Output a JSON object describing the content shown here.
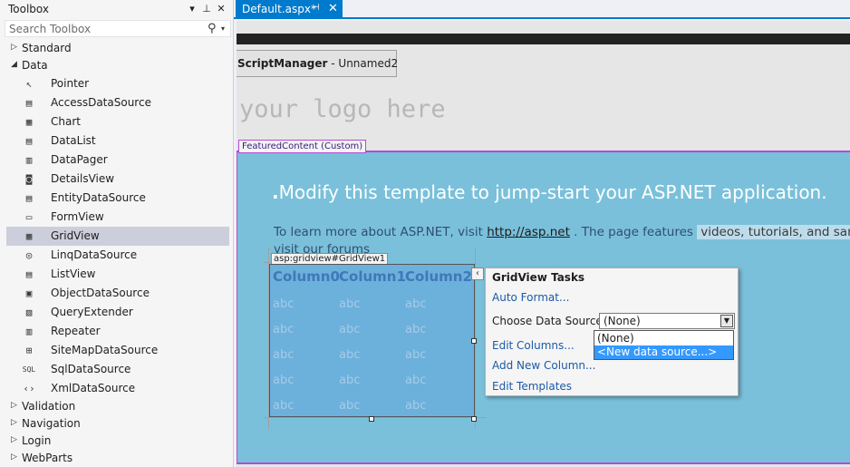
{
  "toolbox": {
    "title": "Toolbox",
    "header_buttons": {
      "dropdown": "▾",
      "pin": "⊥",
      "close": "✕"
    },
    "search": {
      "placeholder": "Search Toolbox",
      "value": ""
    },
    "categories_top": [
      {
        "name": "Standard",
        "expanded": false
      },
      {
        "name": "Data",
        "expanded": true
      }
    ],
    "data_items": [
      {
        "label": "Pointer",
        "icon": "pointer-icon",
        "glyph": "↖"
      },
      {
        "label": "AccessDataSource",
        "icon": "datasource-icon",
        "glyph": "▤"
      },
      {
        "label": "Chart",
        "icon": "chart-icon",
        "glyph": "▦"
      },
      {
        "label": "DataList",
        "icon": "datalist-icon",
        "glyph": "▤"
      },
      {
        "label": "DataPager",
        "icon": "datapager-icon",
        "glyph": "▥"
      },
      {
        "label": "DetailsView",
        "icon": "detailsview-icon",
        "glyph": "◙"
      },
      {
        "label": "EntityDataSource",
        "icon": "entitydatasource-icon",
        "glyph": "▤"
      },
      {
        "label": "FormView",
        "icon": "formview-icon",
        "glyph": "▭"
      },
      {
        "label": "GridView",
        "icon": "gridview-icon",
        "glyph": "▦",
        "selected": true
      },
      {
        "label": "LinqDataSource",
        "icon": "linqdatasource-icon",
        "glyph": "◎"
      },
      {
        "label": "ListView",
        "icon": "listview-icon",
        "glyph": "▤"
      },
      {
        "label": "ObjectDataSource",
        "icon": "objectdatasource-icon",
        "glyph": "▣"
      },
      {
        "label": "QueryExtender",
        "icon": "queryextender-icon",
        "glyph": "▧"
      },
      {
        "label": "Repeater",
        "icon": "repeater-icon",
        "glyph": "▥"
      },
      {
        "label": "SiteMapDataSource",
        "icon": "sitemapdatasource-icon",
        "glyph": "⊞"
      },
      {
        "label": "SqlDataSource",
        "icon": "sqldatasource-icon",
        "glyph": "SQL"
      },
      {
        "label": "XmlDataSource",
        "icon": "xmldatasource-icon",
        "glyph": "‹›"
      }
    ],
    "categories_bottom": [
      {
        "name": "Validation",
        "expanded": false
      },
      {
        "name": "Navigation",
        "expanded": false
      },
      {
        "name": "Login",
        "expanded": false
      },
      {
        "name": "WebParts",
        "expanded": false
      }
    ]
  },
  "tab": {
    "label": "Default.aspx*",
    "pin": "⊣",
    "close": "✕"
  },
  "design": {
    "script_manager": {
      "type": "ScriptManager",
      "name": " - Unnamed2"
    },
    "logo_text": "your logo here",
    "featured_tag": "FeaturedContent (Custom)",
    "headline_dot": ".",
    "headline": "Modify this template to jump-start your ASP.NET application.",
    "intro_before": "To learn more about ASP.NET, visit ",
    "intro_link": "http://asp.net",
    "intro_after": " . The page features ",
    "intro_highlight": "videos, tutorials, and samp",
    "intro_line2": "visit  our forums",
    "gridview": {
      "label": "asp:gridview#GridView1",
      "smart_tag": "‹",
      "columns": [
        "Column0",
        "Column1",
        "Column2"
      ],
      "rows": [
        [
          "abc",
          "abc",
          "abc"
        ],
        [
          "abc",
          "abc",
          "abc"
        ],
        [
          "abc",
          "abc",
          "abc"
        ],
        [
          "abc",
          "abc",
          "abc"
        ],
        [
          "abc",
          "abc",
          "abc"
        ]
      ]
    },
    "tasks": {
      "title": "GridView Tasks",
      "auto_format": "Auto Format...",
      "choose_label": "Choose Data Source:",
      "choose_value": "(None)",
      "options": [
        "(None)",
        "<New data source...>"
      ],
      "selected_option": "<New data source...>",
      "edit_columns": "Edit Columns...",
      "add_column": "Add New Column...",
      "edit_templates": "Edit Templates"
    }
  },
  "colors": {
    "accent": "#007acc",
    "featured_bg": "#7ac0da",
    "template_border": "#b34bd4",
    "link": "#1c5aa6",
    "selection": "#3399ff"
  }
}
